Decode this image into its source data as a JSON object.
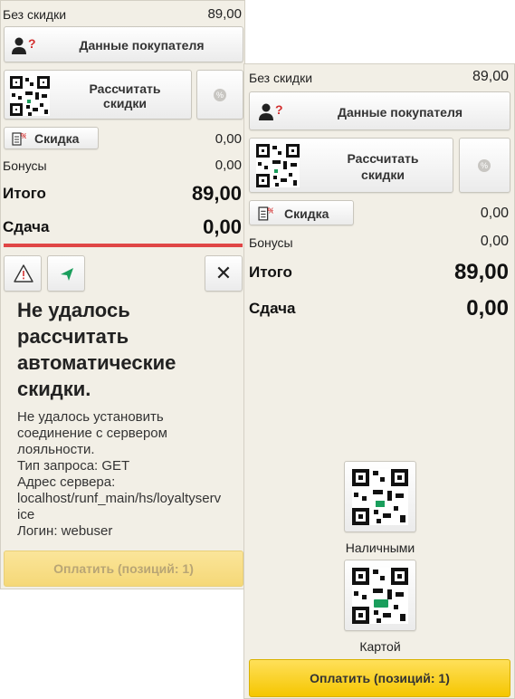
{
  "left": {
    "without_discount_label": "Без скидки",
    "without_discount_value": "89,00",
    "customer_button": "Данные покупателя",
    "calc_button_line1": "Рассчитать",
    "calc_button_line2": "скидки",
    "percent_symbol": "%",
    "discount_button": "Скидка",
    "discount_value": "0,00",
    "bonuses_label": "Бонусы",
    "bonuses_value": "0,00",
    "total_label": "Итого",
    "total_value": "89,00",
    "change_label": "Сдача",
    "change_value": "0,00",
    "close_symbol": "✕",
    "error_title": "Не удалось рассчитать автоматические скидки.",
    "error_body_lines": [
      "Не удалось установить",
      "соединение с сервером",
      "лояльности.",
      "Тип запроса: GET",
      "Адрес сервера:",
      "localhost/runf_main/hs/loyaltyserv",
      "ice",
      "Логин: webuser"
    ],
    "pay_button": "Оплатить (позиций: 1)"
  },
  "right": {
    "without_discount_label": "Без скидки",
    "without_discount_value": "89,00",
    "customer_button": "Данные покупателя",
    "calc_button_line1": "Рассчитать",
    "calc_button_line2": "скидки",
    "percent_symbol": "%",
    "discount_button": "Скидка",
    "discount_value": "0,00",
    "bonuses_label": "Бонусы",
    "bonuses_value": "0,00",
    "total_label": "Итого",
    "total_value": "89,00",
    "change_label": "Сдача",
    "change_value": "0,00",
    "cash_label": "Наличными",
    "card_label": "Картой",
    "pay_button": "Оплатить (позиций: 1)"
  },
  "colors": {
    "panel_bg": "#f2efe6",
    "error_line": "#e04646",
    "send_icon": "#1a9e5c",
    "pay_active": "#f5c600",
    "pay_disabled": "#f5d877"
  },
  "icons": [
    "user-icon",
    "question-mark-icon",
    "qr-icon",
    "percent-icon",
    "discount-doc-icon",
    "warning-icon",
    "send-icon",
    "close-icon"
  ]
}
